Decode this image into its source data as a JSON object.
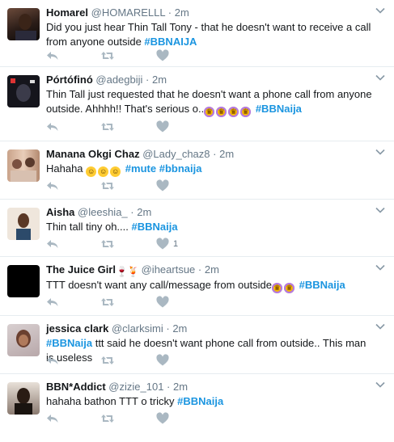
{
  "tweets": [
    {
      "name": "Homarel",
      "handle": "@HOMARELLL",
      "time": "2m",
      "text": "Did you just hear Thin Tall Tony - that he doesn't want to receive a call from anyone outside",
      "hashtag": "#BBNAIJA",
      "avatar": "avatar-homarel"
    },
    {
      "name": "Pórtófinó",
      "handle": "@adegbiji",
      "time": "2m",
      "text": "Thin Tall just requested that he doesn't want a phone call from anyone outside. Ahhhh!! That's serious o..",
      "hashtag": "#BBNaija",
      "emojis": [
        "crown-emoji",
        "crown-emoji",
        "crown-emoji",
        "crown-emoji"
      ],
      "avatar": "avatar-portofino"
    },
    {
      "name": "Manana Okgi Chaz",
      "handle": "@Lady_chaz8",
      "time": "2m",
      "text": "Hahaha",
      "emojis": [
        "joy-emoji",
        "joy-emoji",
        "joy-emoji"
      ],
      "hashtags": [
        "#mute",
        "#bbnaija"
      ],
      "avatar": "avatar-manana"
    },
    {
      "name": "Aisha",
      "handle": "@leeshia_",
      "time": "2m",
      "text": "Thin tall tiny oh....",
      "hashtag": "#BBNaija",
      "like_count": "1",
      "avatar": "avatar-aisha"
    },
    {
      "name": "The Juice Girl",
      "handle": "@iheartsue",
      "time": "2m",
      "name_emojis": [
        "wine-glass-emoji",
        "tropical-drink-emoji"
      ],
      "text": "TTT doesn't want any call/message from outside",
      "emojis": [
        "crown-emoji",
        "crown-emoji"
      ],
      "hashtag": "#BBNaija",
      "avatar": "avatar-juicegirl"
    },
    {
      "name": "jessica clark",
      "handle": "@clarksimi",
      "time": "2m",
      "hashtag": "#BBNaija",
      "text": "ttt said he doesn't want phone call from outside.. This man is useless",
      "avatar": "avatar-jessica"
    },
    {
      "name": "BBN*Addict",
      "handle": "@zizie_101",
      "time": "2m",
      "text": "hahaha bathon TTT o tricky",
      "hashtag": "#BBNaija",
      "avatar": "avatar-bbnaddict"
    }
  ],
  "separator": "·",
  "colors": {
    "hashtag": "#1b95e0",
    "muted": "#657786",
    "icon": "#aab8c2",
    "border": "#e6ecf0"
  }
}
